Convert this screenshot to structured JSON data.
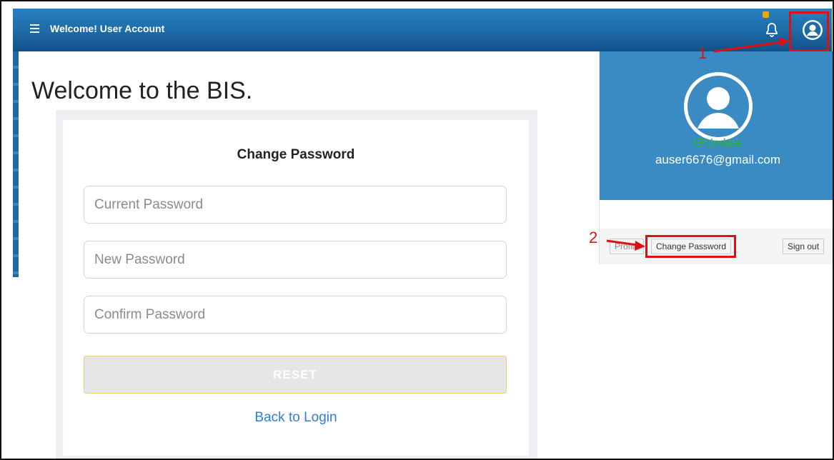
{
  "header": {
    "title": "Welcome! User Account",
    "menu_icon": "hamburger-icon",
    "notification_icon": "bell-icon",
    "user_icon": "user-avatar-icon",
    "color": "#1d6aa6"
  },
  "main": {
    "welcome_text": "Welcome to the BIS."
  },
  "form": {
    "title": "Change Password",
    "current_placeholder": "Current Password",
    "new_placeholder": "New Password",
    "confirm_placeholder": "Confirm Password",
    "reset_label": "RESET",
    "back_link": "Back to Login"
  },
  "dropdown": {
    "update_label": "Update",
    "update_icon": "edit-icon",
    "email": "auser6676@gmail.com",
    "profile_label": "Profile",
    "change_password_label": "Change Password",
    "signout_label": "Sign out",
    "header_color": "#3a8bc4"
  },
  "annotations": {
    "step1": "1",
    "step2": "2",
    "color": "#e01010"
  }
}
